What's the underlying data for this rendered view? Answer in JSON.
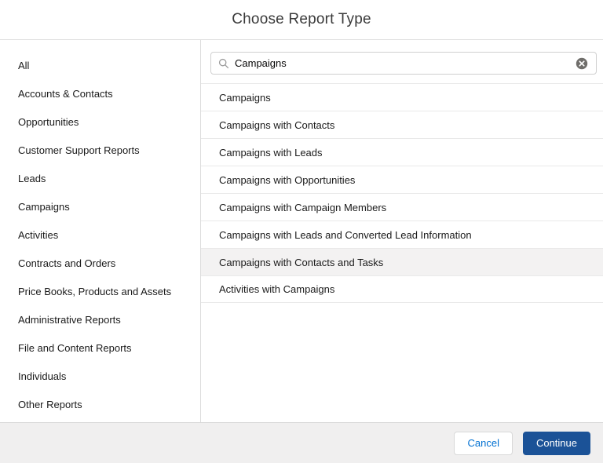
{
  "modal": {
    "title": "Choose Report Type"
  },
  "sidebar": {
    "items": [
      {
        "label": "All"
      },
      {
        "label": "Accounts & Contacts"
      },
      {
        "label": "Opportunities"
      },
      {
        "label": "Customer Support Reports"
      },
      {
        "label": "Leads"
      },
      {
        "label": "Campaigns"
      },
      {
        "label": "Activities"
      },
      {
        "label": "Contracts and Orders"
      },
      {
        "label": "Price Books, Products and Assets"
      },
      {
        "label": "Administrative Reports"
      },
      {
        "label": "File and Content Reports"
      },
      {
        "label": "Individuals"
      },
      {
        "label": "Other Reports"
      }
    ]
  },
  "search": {
    "value": "Campaigns",
    "search_icon": "magnifier",
    "clear_icon": "circle-x"
  },
  "results": [
    {
      "label": "Campaigns",
      "highlighted": false
    },
    {
      "label": "Campaigns with Contacts",
      "highlighted": false
    },
    {
      "label": "Campaigns with Leads",
      "highlighted": false
    },
    {
      "label": "Campaigns with Opportunities",
      "highlighted": false
    },
    {
      "label": "Campaigns with Campaign Members",
      "highlighted": false
    },
    {
      "label": "Campaigns with Leads and Converted Lead Information",
      "highlighted": false
    },
    {
      "label": "Campaigns with Contacts and Tasks",
      "highlighted": true
    },
    {
      "label": "Activities with Campaigns",
      "highlighted": false
    }
  ],
  "footer": {
    "cancel_label": "Cancel",
    "continue_label": "Continue"
  },
  "colors": {
    "brand_button_bg": "#1b5297",
    "cancel_text": "#0070d2",
    "highlight_row_bg": "#f3f2f2",
    "footer_bg": "#f0efef",
    "divider": "#e0e0e0"
  }
}
